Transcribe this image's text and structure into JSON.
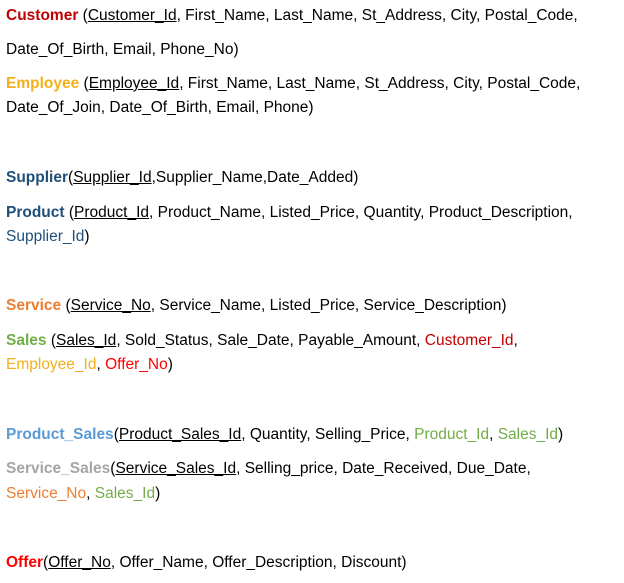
{
  "colors": {
    "customer": "#c00000",
    "employee": "#f2b01e",
    "supplier": "#1f4e79",
    "product": "#1f4e79",
    "service": "#ed7d31",
    "sales": "#70ad47",
    "product_sales": "#5b9bd5",
    "service_sales": "#a5a5a5",
    "offer": "#ff0000"
  },
  "customer": {
    "name": "Customer",
    "open": " (",
    "pk": "Customer_Id",
    "l1": ", First_Name, Last_Name, St_Address, City, Postal_Code,",
    "l2": "Date_Of_Birth, Email, Phone_No)"
  },
  "employee": {
    "name": "Employee",
    "open": " (",
    "pk": "Employee_Id",
    "l1": ", First_Name, Last_Name, St_Address, City, Postal_Code,",
    "l2": "Date_Of_Join, Date_Of_Birth, Email, Phone)"
  },
  "supplier": {
    "name": "Supplier",
    "open": "(",
    "pk": "Supplier_Id",
    "l1": ",Supplier_Name,Date_Added)"
  },
  "product": {
    "name": "Product",
    "open": " (",
    "pk": "Product_Id",
    "l1": ", Product_Name, Listed_Price, Quantity, Product_Description,",
    "fk1": "Supplier_Id",
    "l2_end": ")"
  },
  "service": {
    "name": "Service",
    "open": " (",
    "pk": "Service_No",
    "l1": ", Service_Name, Listed_Price, Service_Description)"
  },
  "sales": {
    "name": "Sales",
    "open": " (",
    "pk": "Sales_Id",
    "l1": ", Sold_Status, Sale_Date, Payable_Amount, ",
    "fk_customer": "Customer_Id",
    "comma1": ",",
    "fk_employee": "Employee_Id",
    "comma2": ", ",
    "fk_offer": "Offer_No",
    "close": ")"
  },
  "product_sales": {
    "name": "Product_Sales",
    "open": "(",
    "pk": "Product_Sales_Id",
    "l1": ", Quantity, Selling_Price, ",
    "fk_product": "Product_Id",
    "comma": ", ",
    "fk_sales": "Sales_Id",
    "close": ")"
  },
  "service_sales": {
    "name": "Service_Sales",
    "open": "(",
    "pk": "Service_Sales_Id",
    "l1": ", Selling_price, Date_Received, Due_Date,",
    "fk_service": "Service_No",
    "comma": ", ",
    "fk_sales": "Sales_Id",
    "close": ")"
  },
  "offer": {
    "name": "Offer",
    "open": "(",
    "pk": "Offer_No",
    "l1": ", Offer_Name, Offer_Description, Discount)"
  }
}
